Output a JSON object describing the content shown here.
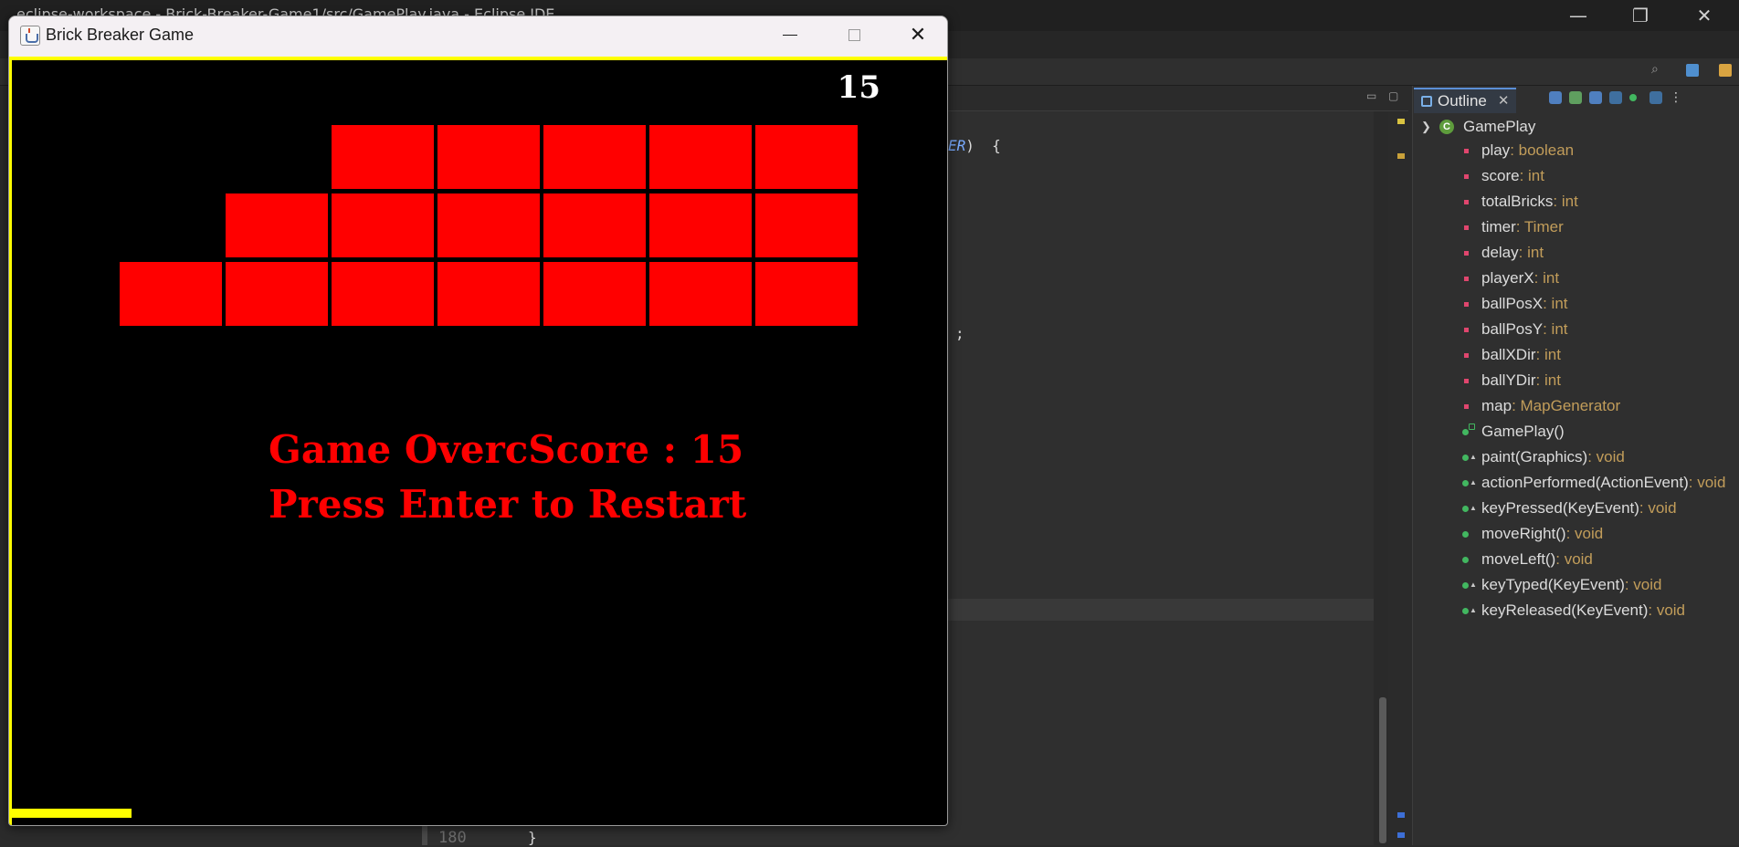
{
  "ide": {
    "title": "eclipse-workspace - Brick-Breaker-Game1/src/GamePlay.java - Eclipse IDE",
    "window_controls": {
      "minimize": "—",
      "maximize": "❐",
      "close": "✕"
    },
    "code_line_1_a": "ER",
    "code_line_1_b": ")  {",
    "code_line_2": ";",
    "line_number": "180",
    "code_line_3": "}"
  },
  "outline": {
    "tab_label": "Outline",
    "tab_close": "✕",
    "root": "GamePlay",
    "items": [
      {
        "name": "play",
        "type": " : boolean",
        "kind": "field"
      },
      {
        "name": "score",
        "type": " : int",
        "kind": "field"
      },
      {
        "name": "totalBricks",
        "type": " : int",
        "kind": "field"
      },
      {
        "name": "timer",
        "type": " : Timer",
        "kind": "field"
      },
      {
        "name": "delay",
        "type": " : int",
        "kind": "field"
      },
      {
        "name": "playerX",
        "type": " : int",
        "kind": "field"
      },
      {
        "name": "ballPosX",
        "type": " : int",
        "kind": "field"
      },
      {
        "name": "ballPosY",
        "type": " : int",
        "kind": "field"
      },
      {
        "name": "ballXDir",
        "type": " : int",
        "kind": "field"
      },
      {
        "name": "ballYDir",
        "type": " : int",
        "kind": "field"
      },
      {
        "name": "map",
        "type": " : MapGenerator",
        "kind": "field"
      },
      {
        "name": "GamePlay()",
        "type": "",
        "kind": "ctor"
      },
      {
        "name": "paint(Graphics)",
        "type": " : void",
        "kind": "override"
      },
      {
        "name": "actionPerformed(ActionEvent)",
        "type": " : void",
        "kind": "override"
      },
      {
        "name": "keyPressed(KeyEvent)",
        "type": " : void",
        "kind": "override"
      },
      {
        "name": "moveRight()",
        "type": " : void",
        "kind": "method"
      },
      {
        "name": "moveLeft()",
        "type": " : void",
        "kind": "method"
      },
      {
        "name": "keyTyped(KeyEvent)",
        "type": " : void",
        "kind": "override"
      },
      {
        "name": "keyReleased(KeyEvent)",
        "type": " : void",
        "kind": "override"
      }
    ]
  },
  "game": {
    "window_title": "Brick Breaker Game",
    "score": "15",
    "message_line1": "Game OvercScore : 15",
    "message_line2": "Press Enter to Restart",
    "brick_color": "#ff0000",
    "border_color": "#ffff00",
    "brick_rows": [
      {
        "visible": [
          false,
          false,
          true,
          true,
          true,
          true,
          true
        ]
      },
      {
        "visible": [
          false,
          true,
          true,
          true,
          true,
          true,
          true
        ]
      },
      {
        "visible": [
          true,
          true,
          true,
          true,
          true,
          true,
          true
        ]
      }
    ]
  }
}
